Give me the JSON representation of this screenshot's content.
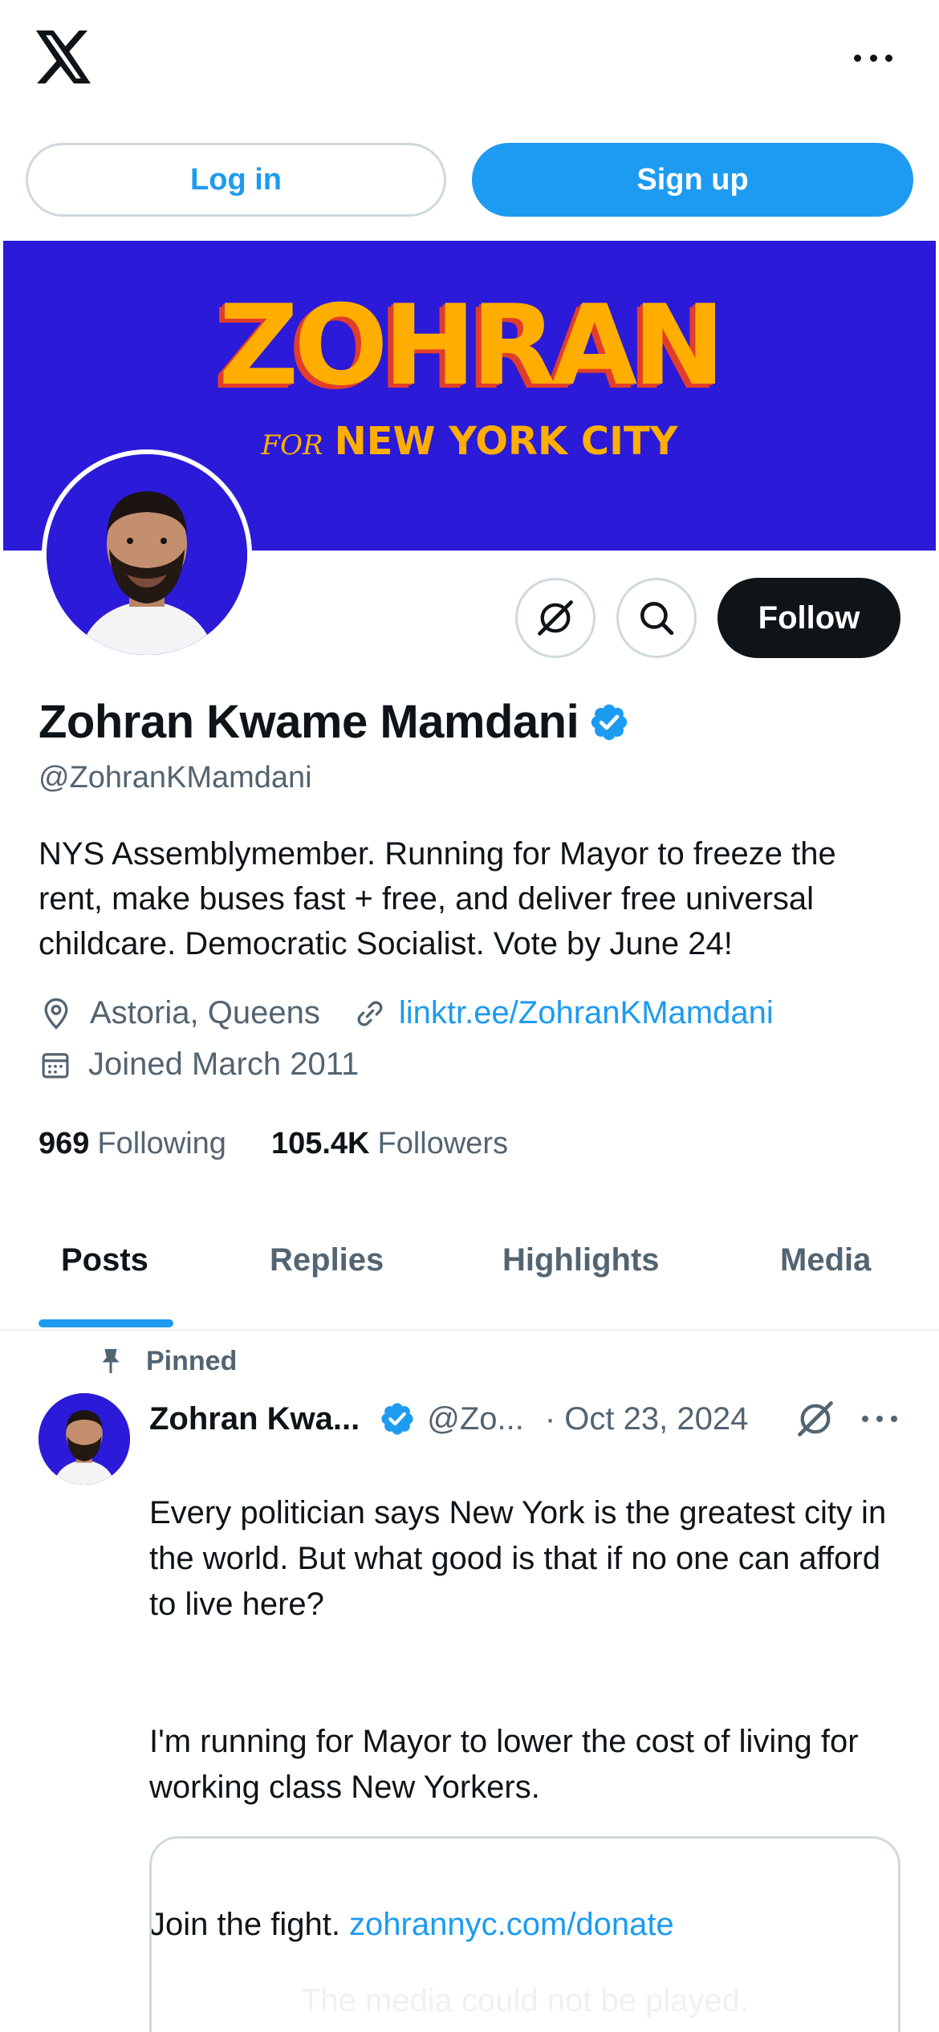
{
  "header": {
    "logo_icon": "x-logo-icon",
    "more_icon": "more-horizontal-icon"
  },
  "auth": {
    "login_label": "Log in",
    "signup_label": "Sign up"
  },
  "banner": {
    "title": "ZOHRAN",
    "for_text": "FOR",
    "subtitle": "NEW YORK CITY",
    "background_color": "#2b1ad8",
    "text_color": "#ffae00"
  },
  "profile": {
    "display_name": "Zohran Kwame Mamdani",
    "handle": "@ZohranKMamdani",
    "bio": "NYS Assemblymember. Running for Mayor to freeze the rent, make buses fast + free, and deliver free universal childcare. Democratic Socialist. Vote by June 24!",
    "location": "Astoria, Queens",
    "website": "linktr.ee/ZohranKMamdani",
    "joined": "Joined March 2011",
    "following_count": "969",
    "following_label": "Following",
    "followers_count": "105.4K",
    "followers_label": "Followers",
    "follow_label": "Follow",
    "verified_color": "#1d9bf0"
  },
  "tabs": [
    {
      "label": "Posts",
      "active": true
    },
    {
      "label": "Replies",
      "active": false
    },
    {
      "label": "Highlights",
      "active": false
    },
    {
      "label": "Media",
      "active": false
    }
  ],
  "post": {
    "pinned_label": "Pinned",
    "author_name": "Zohran Kwa...",
    "author_handle": "@Zo...",
    "date": "· Oct 23, 2024",
    "paragraph1": "Every politician says New York is the greatest city in the world. But what good is that if no one can afford to live here?",
    "paragraph2": "I'm running for Mayor to lower the cost of living for working class New Yorkers.",
    "paragraph3_prefix": "Join the fight. ",
    "paragraph3_link": "zohrannyc.com/donate",
    "media_message": "The media could not be played."
  },
  "colors": {
    "accent": "#1d9bf0",
    "text_primary": "#0f1419",
    "text_secondary": "#536471",
    "border": "#cfd9de"
  }
}
